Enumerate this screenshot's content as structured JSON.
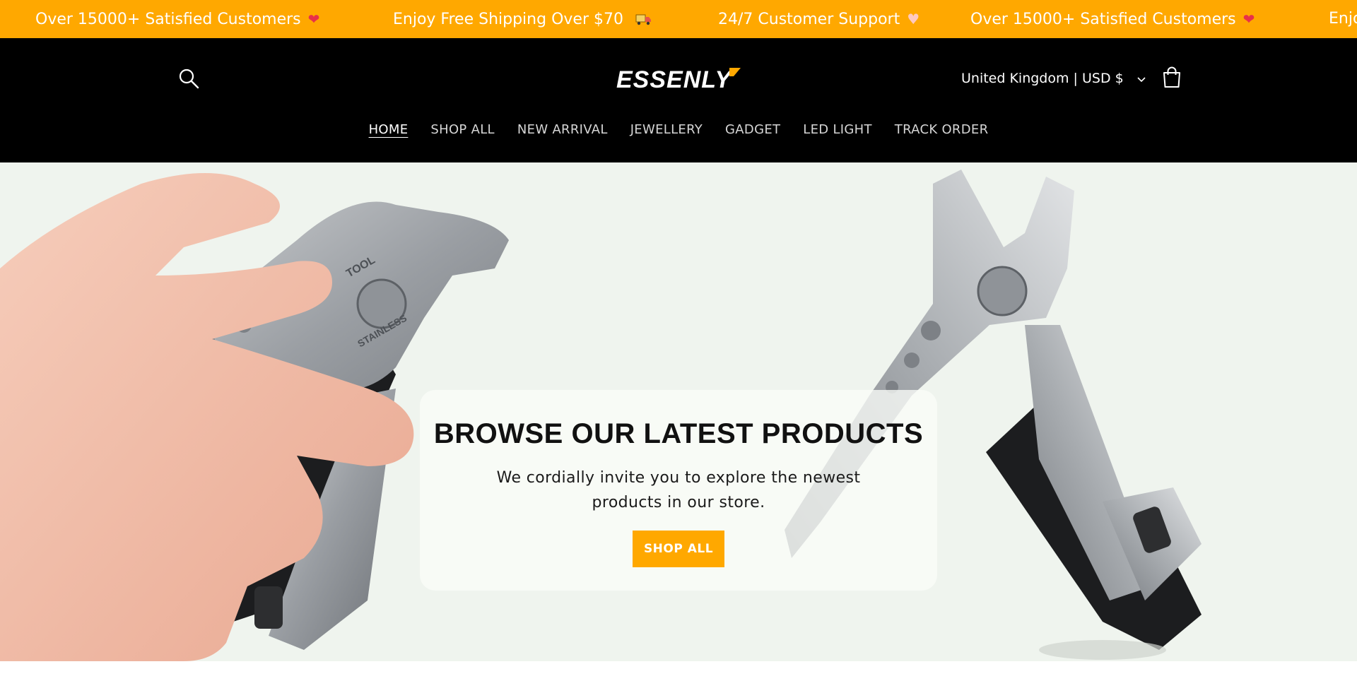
{
  "announcement": {
    "items": [
      {
        "text": "Over 15000+ Satisfied Customers",
        "icon": "heart-icon"
      },
      {
        "text": "Enjoy Free Shipping Over $70",
        "icon": "truck-icon"
      },
      {
        "text": "24/7 Customer Support",
        "icon": "heart-hands-icon"
      },
      {
        "text": "Over 15000+ Satisfied Customers",
        "icon": "heart-icon"
      },
      {
        "text": "Enjo",
        "icon": ""
      }
    ],
    "background": "#ffa800"
  },
  "header": {
    "logo_text": "ESSENLY",
    "country_selector": "United Kingdom | USD $",
    "icons": {
      "search": "search-icon",
      "cart": "cart-icon",
      "dropdown": "chevron-down-icon"
    }
  },
  "nav": {
    "items": [
      {
        "label": "HOME",
        "active": true
      },
      {
        "label": "SHOP ALL",
        "active": false
      },
      {
        "label": "NEW ARRIVAL",
        "active": false
      },
      {
        "label": "JEWELLERY",
        "active": false
      },
      {
        "label": "GADGET",
        "active": false
      },
      {
        "label": "LED LIGHT",
        "active": false
      },
      {
        "label": "TRACK ORDER",
        "active": false
      }
    ]
  },
  "hero": {
    "title": "BROWSE OUR LATEST PRODUCTS",
    "subtitle": "We cordially invite you to explore the newest products in our store.",
    "button_label": "SHOP ALL",
    "accent_color": "#ffa800",
    "tool_marking_1": "TOOL",
    "tool_marking_2": "STAINLESS"
  }
}
